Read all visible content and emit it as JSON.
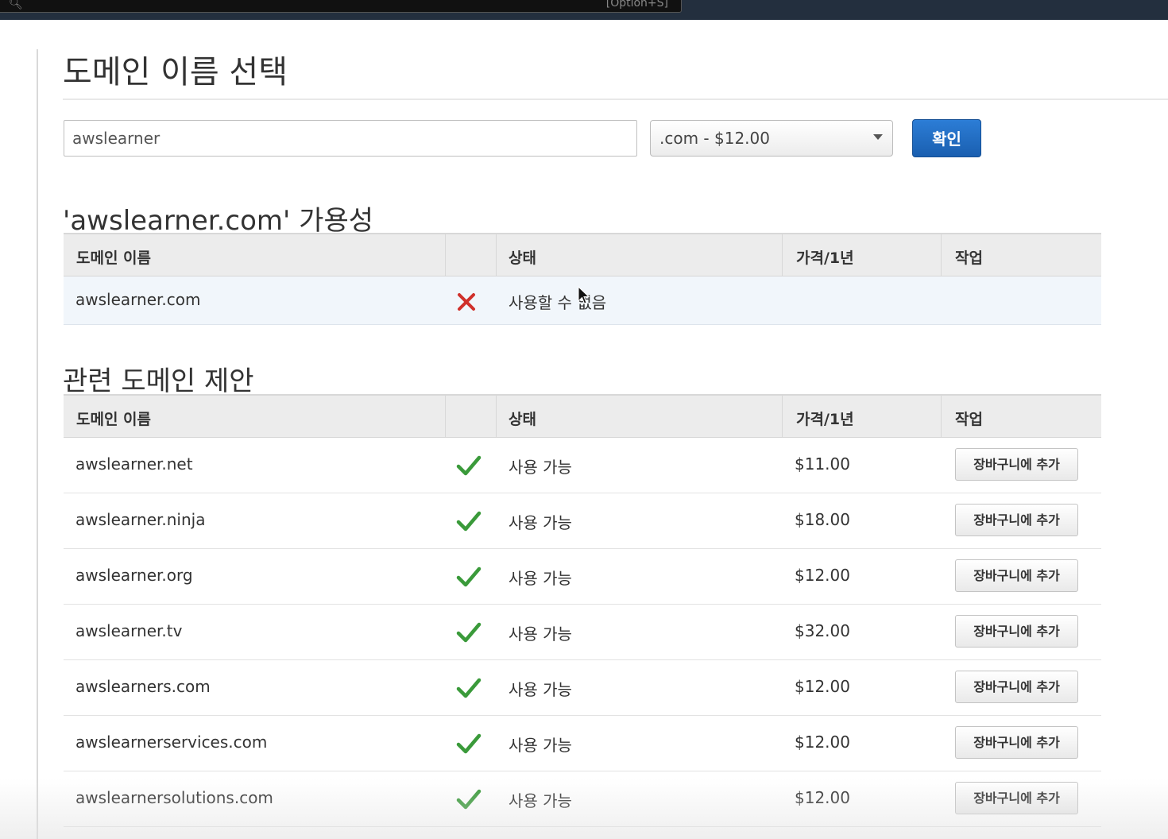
{
  "topbar": {
    "search_hint": "[Option+S]"
  },
  "page_title": "도메인 이름 선택",
  "search": {
    "input_value": "awslearner",
    "tld_selected": ".com - $12.00",
    "confirm_label": "확인"
  },
  "availability": {
    "title": "'awslearner.com' 가용성",
    "columns": [
      "도메인 이름",
      "상태",
      "가격/1년",
      "작업"
    ],
    "row": {
      "domain": "awslearner.com",
      "status_icon": "x-icon",
      "status": "사용할 수 없음",
      "price": "",
      "action": ""
    }
  },
  "suggestions": {
    "title": "관련 도메인 제안",
    "columns": [
      "도메인 이름",
      "상태",
      "가격/1년",
      "작업"
    ],
    "rows": [
      {
        "domain": "awslearner.net",
        "status_icon": "check-icon",
        "status": "사용 가능",
        "price": "$11.00",
        "action": "장바구니에 추가"
      },
      {
        "domain": "awslearner.ninja",
        "status_icon": "check-icon",
        "status": "사용 가능",
        "price": "$18.00",
        "action": "장바구니에 추가"
      },
      {
        "domain": "awslearner.org",
        "status_icon": "check-icon",
        "status": "사용 가능",
        "price": "$12.00",
        "action": "장바구니에 추가"
      },
      {
        "domain": "awslearner.tv",
        "status_icon": "check-icon",
        "status": "사용 가능",
        "price": "$32.00",
        "action": "장바구니에 추가"
      },
      {
        "domain": "awslearners.com",
        "status_icon": "check-icon",
        "status": "사용 가능",
        "price": "$12.00",
        "action": "장바구니에 추가"
      },
      {
        "domain": "awslearnerservices.com",
        "status_icon": "check-icon",
        "status": "사용 가능",
        "price": "$12.00",
        "action": "장바구니에 추가"
      },
      {
        "domain": "awslearnersolutions.com",
        "status_icon": "check-icon",
        "status": "사용 가능",
        "price": "$12.00",
        "action": "장바구니에 추가"
      }
    ]
  },
  "colors": {
    "primary_button": "#1f6fc5",
    "check": "#3a9a3a",
    "cross": "#d0302a",
    "header_bg": "#ececec",
    "highlight_row": "#f1f6fb"
  }
}
